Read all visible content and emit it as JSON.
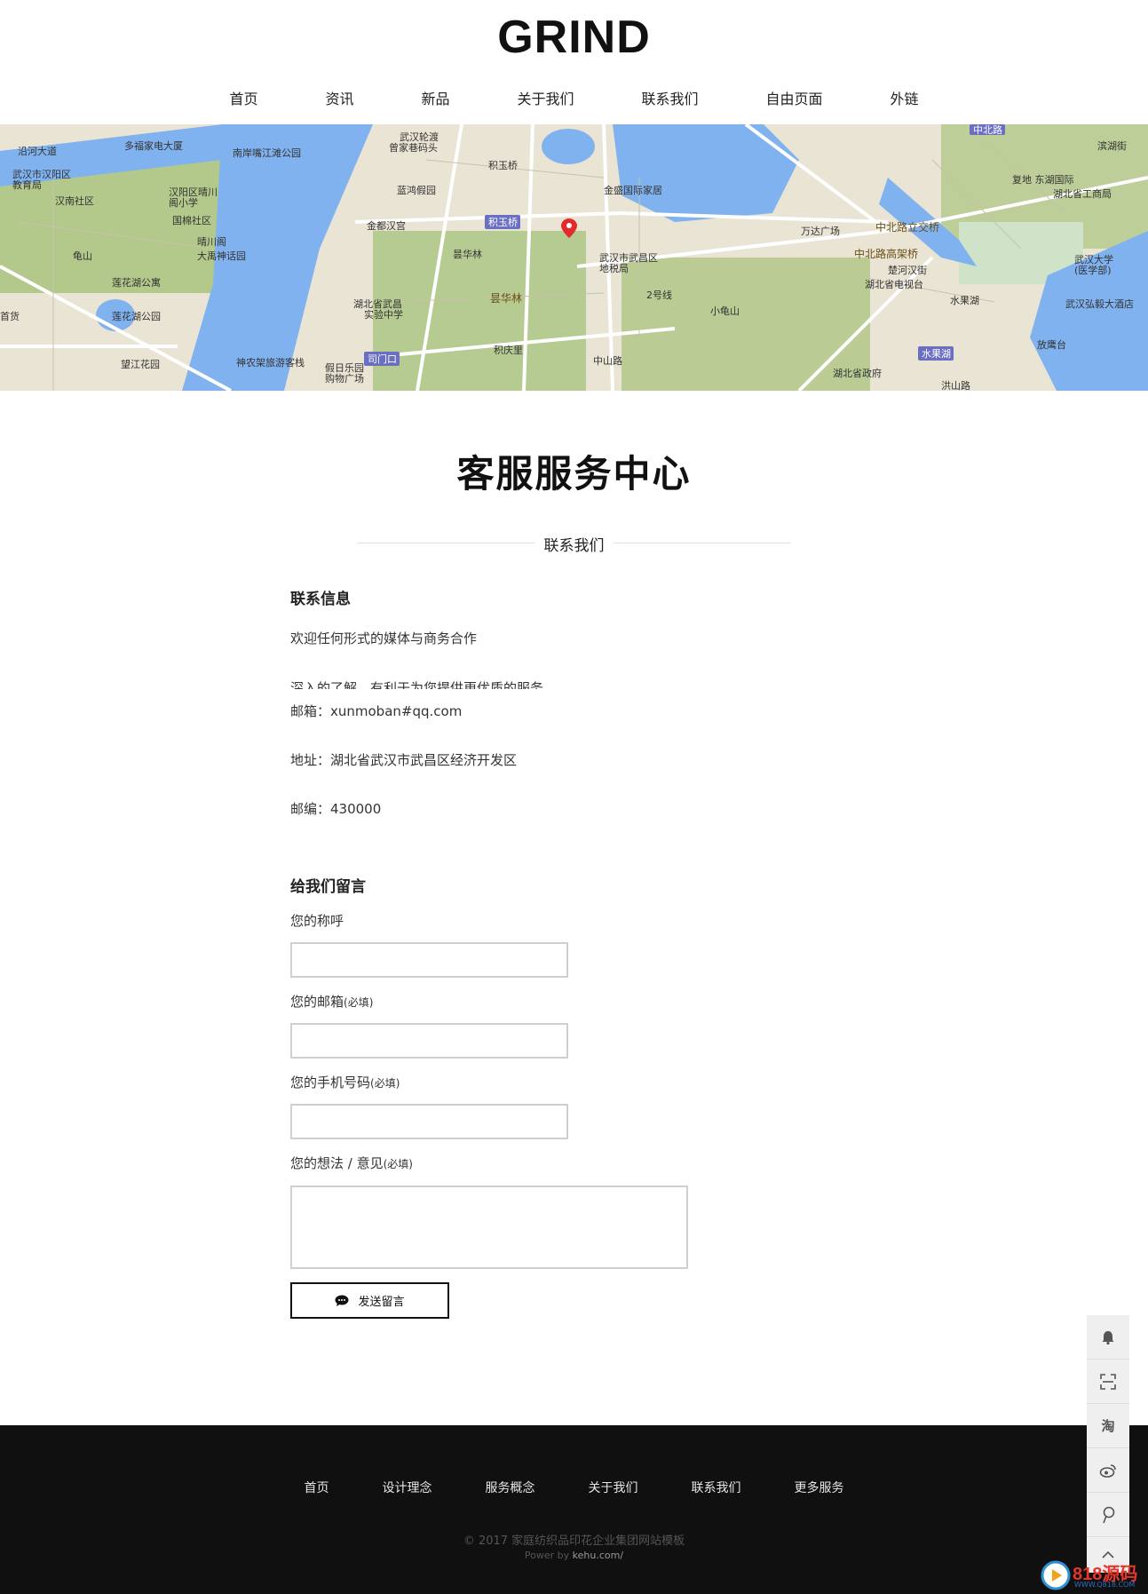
{
  "header": {
    "logo": "GRIND",
    "nav": [
      "首页",
      "资讯",
      "新品",
      "关于我们",
      "联系我们",
      "自由页面",
      "外链"
    ]
  },
  "map": {
    "labels": [
      "沿河大道",
      "多福家电大厦",
      "南岸嘴江滩公园",
      "武汉市汉阳区教育局",
      "汉南社区",
      "汉阳区晴川阁小学",
      "国棉社区",
      "晴川阁",
      "大禹神话园",
      "龟山",
      "莲花湖公寓",
      "莲花湖公园",
      "首货",
      "望江花园",
      "神农架旅游客栈",
      "假日乐园购物广场",
      "武汉轮渡曾家巷码头",
      "积玉桥",
      "蓝鸿假园",
      "金都汉宫",
      "昙华林",
      "湖北省武昌实验中学",
      "积庆里",
      "金盛国际家居",
      "武汉市武昌区地税局",
      "小龟山",
      "万达广场",
      "中北路立交桥",
      "中北路高架桥",
      "楚河汉街",
      "湖北省电视台",
      "湖北省政府",
      "滨湖街",
      "复地东湖国际",
      "湖北省工商局",
      "武汉大学(医学部)",
      "水果湖",
      "武汉弘毅大酒店",
      "放鹰台",
      "中北路",
      "昙华林",
      "2号线",
      "中山路",
      "洪山路"
    ],
    "tags": [
      "积玉桥",
      "司门口",
      "水果湖",
      "中北路"
    ]
  },
  "main": {
    "title": "客服服务中心",
    "divider": "联系我们",
    "contact": {
      "heading": "联系信息",
      "intro": "欢迎任何形式的媒体与商务合作",
      "clipped": "深入的了解，有利于为您提供更优质的服务",
      "email": "邮箱：xunmoban#qq.com",
      "address": "地址：湖北省武汉市武昌区经济开发区",
      "postcode": "邮编：430000"
    },
    "form": {
      "heading": "给我们留言",
      "name_label": "您的称呼",
      "email_label": "您的邮箱",
      "phone_label": "您的手机号码",
      "message_label": "您的想法 / 意见",
      "required": "(必填)",
      "submit": "发送留言"
    }
  },
  "footer": {
    "nav": [
      "首页",
      "设计理念",
      "服务概念",
      "关于我们",
      "联系我们",
      "更多服务"
    ],
    "copyright": "© 2017 家庭纺织品印花企业集团网站模板",
    "power_prefix": "Power by ",
    "power_link": "kehu.com/"
  },
  "sidebar": {
    "icons": [
      "bell-icon",
      "scan-icon",
      "taobao-icon",
      "weibo-icon",
      "pin-icon",
      "top-icon"
    ],
    "taobao_label": "淘"
  },
  "watermark": {
    "brand": "818源码",
    "site": "WWW.Q818.COM"
  },
  "colors": {
    "water": "#7fb2ee",
    "land": "#e9e4d4",
    "green": "#a9c47f",
    "footer_bg": "#101010",
    "pin": "#e22b2b"
  }
}
